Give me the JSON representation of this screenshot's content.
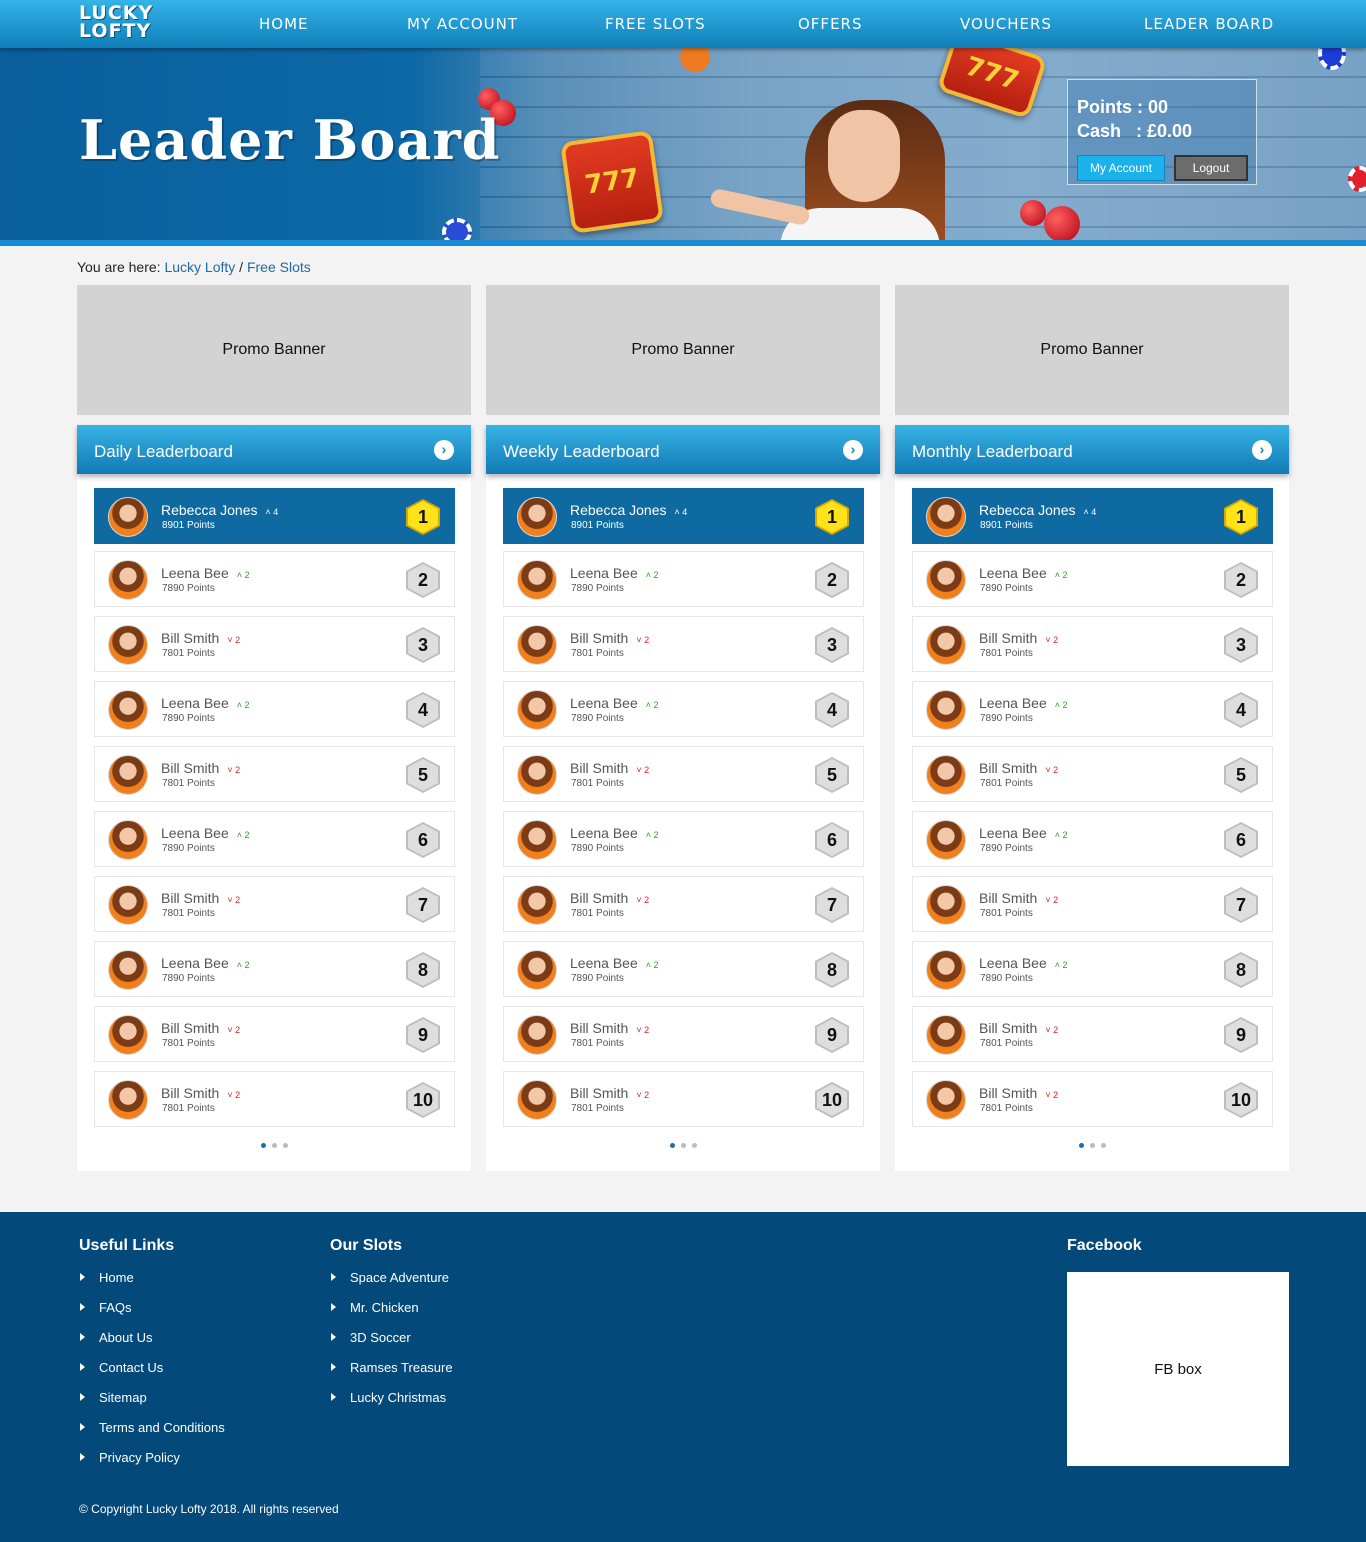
{
  "brand": {
    "logo_line1": "LUCKY",
    "logo_line2": "LOFTY"
  },
  "nav": [
    "HOME",
    "MY ACCOUNT",
    "FREE SLOTS",
    "OFFERS",
    "VOUCHERS",
    "LEADER BOARD"
  ],
  "hero": {
    "title": "Leader Board",
    "slot_text": "777"
  },
  "account": {
    "points": "Points : 00",
    "cash": "Cash   : £0.00",
    "my_account": "My Account",
    "logout": "Logout"
  },
  "breadcrumb": {
    "prefix": "You are here:",
    "home": "Lucky Lofty",
    "sep": "/",
    "current": "Free Slots"
  },
  "promos": [
    "Promo Banner",
    "Promo Banner",
    "Promo Banner"
  ],
  "leaderboards": [
    {
      "title": "Daily Leaderboard"
    },
    {
      "title": "Weekly Leaderboard"
    },
    {
      "title": "Monthly Leaderboard"
    }
  ],
  "entries": [
    {
      "name": "Rebecca Jones",
      "trend": "up",
      "delta": "4",
      "points": "8901 Points",
      "rank": "1"
    },
    {
      "name": "Leena Bee",
      "trend": "up",
      "delta": "2",
      "points": "7890 Points",
      "rank": "2"
    },
    {
      "name": "Bill Smith",
      "trend": "down",
      "delta": "2",
      "points": "7801 Points",
      "rank": "3"
    },
    {
      "name": "Leena Bee",
      "trend": "up",
      "delta": "2",
      "points": "7890 Points",
      "rank": "4"
    },
    {
      "name": "Bill Smith",
      "trend": "down",
      "delta": "2",
      "points": "7801 Points",
      "rank": "5"
    },
    {
      "name": "Leena Bee",
      "trend": "up",
      "delta": "2",
      "points": "7890 Points",
      "rank": "6"
    },
    {
      "name": "Bill Smith",
      "trend": "down",
      "delta": "2",
      "points": "7801 Points",
      "rank": "7"
    },
    {
      "name": "Leena Bee",
      "trend": "up",
      "delta": "2",
      "points": "7890 Points",
      "rank": "8"
    },
    {
      "name": "Bill Smith",
      "trend": "down",
      "delta": "2",
      "points": "7801 Points",
      "rank": "9"
    },
    {
      "name": "Bill Smith",
      "trend": "down",
      "delta": "2",
      "points": "7801 Points",
      "rank": "10"
    }
  ],
  "pagination": {
    "pages": 3,
    "active": 1
  },
  "footer": {
    "useful_links_title": "Useful Links",
    "useful_links": [
      "Home",
      "FAQs",
      "About Us",
      "Contact Us",
      "Sitemap",
      "Terms and Conditions",
      "Privacy Policy"
    ],
    "slots_title": "Our Slots",
    "slots": [
      "Space Adventure",
      "Mr. Chicken",
      "3D Soccer",
      "Ramses Treasure",
      "Lucky Christmas"
    ],
    "facebook_title": "Facebook",
    "fb_box": "FB box",
    "copyright": "© Copyright Lucky Lofty 2018. All rights reserved"
  },
  "colors": {
    "nav": "#1a96d2",
    "hero": "#0c68a6",
    "footer": "#03497a",
    "top_row": "#0e6aa0",
    "gold_rank": "#ffe21a",
    "trend_up": "#26a51d",
    "trend_down": "#e02020"
  }
}
